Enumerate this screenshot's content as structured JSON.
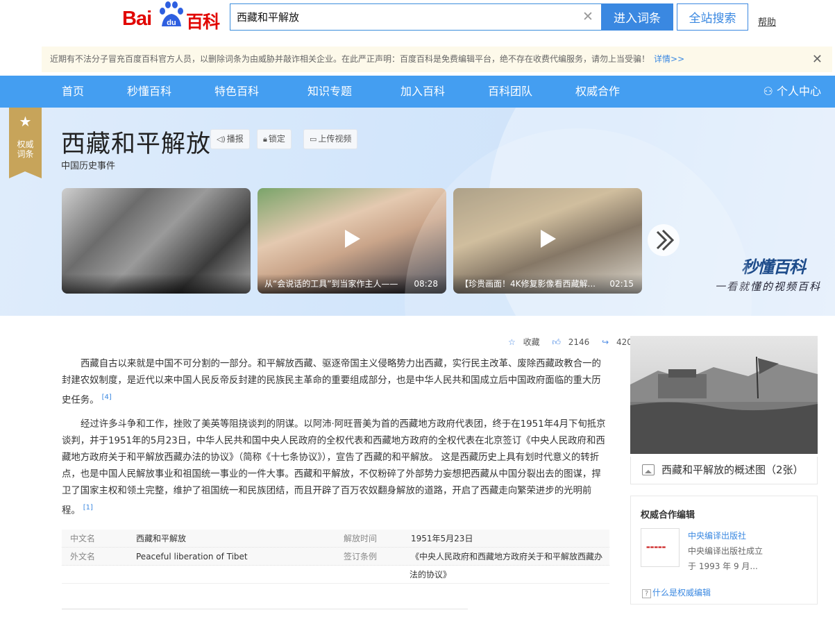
{
  "header": {
    "logo_bai": "Bai",
    "logo_du": "du",
    "logo_ke": "百科",
    "search_value": "西藏和平解放",
    "enter_label": "进入词条",
    "site_search_label": "全站搜索",
    "help_label": "帮助"
  },
  "notice": {
    "text": "近期有不法分子冒充百度百科官方人员，以删除词条为由威胁并敲诈相关企业。在此严正声明：百度百科是免费编辑平台，绝不存在收费代编服务，请勿上当受骗！",
    "more": "详情>>"
  },
  "nav": {
    "items": [
      "首页",
      "秒懂百科",
      "特色百科",
      "知识专题",
      "加入百科",
      "百科团队",
      "权威合作"
    ],
    "user_center": "个人中心"
  },
  "entry": {
    "badge": "权威词条",
    "title": "西藏和平解放",
    "broadcast_label": "播报",
    "lock_label": "锁定",
    "upload_label": "上传视频",
    "subtitle": "中国历史事件"
  },
  "videos": [
    {
      "caption": "",
      "duration": "",
      "color": "#8d8d8d"
    },
    {
      "caption": "从“会说话的工具”到当家作主人——",
      "duration": "08:28",
      "color": "#7a6a55"
    },
    {
      "caption": "【珍贵画面！4K修复影像看西藏解...",
      "duration": "02:15",
      "color": "#6f6352"
    }
  ],
  "miaodong": {
    "brand": "秒懂百科",
    "slogan": "一看就懂的视频百科"
  },
  "actions": {
    "collect": "收藏",
    "likes": "2146",
    "shares": "420"
  },
  "paragraphs": [
    {
      "text": "西藏自古以来就是中国不可分割的一部分。和平解放西藏、驱逐帝国主义侵略势力出西藏，实行民主改革、废除西藏政教合一的封建农奴制度，是近代以来中国人民反帝反封建的民族民主革命的重要组成部分，也是中华人民共和国成立后中国政府面临的重大历史任务。",
      "ref": "[4]"
    },
    {
      "text": "经过许多斗争和工作，挫败了美英等阻挠谈判的阴谋。以阿沛·阿旺晋美为首的西藏地方政府代表团，终于在1951年4月下旬抵京谈判，并于1951年的5月23日，中华人民共和国中央人民政府的全权代表和西藏地方政府的全权代表在北京签订《中央人民政府和西藏地方政府关于和平解放西藏办法的协议》（简称《十七条协议》），宣告了西藏的和平解放。 这是西藏历史上具有划时代意义的转折点，也是中国人民解放事业和祖国统一事业的一件大事。西藏和平解放，不仅粉碎了外部势力妄想把西藏从中国分裂出去的图谋，捍卫了国家主权和领土完整，维护了祖国统一和民族团结，而且开辟了百万农奴翻身解放的道路，开启了西藏走向繁荣进步的光明前程。",
      "ref": "[1]"
    }
  ],
  "infobox": [
    {
      "k1": "中文名",
      "v1": "西藏和平解放",
      "k2": "解放时间",
      "v2": "1951年5月23日"
    },
    {
      "k1": "外文名",
      "v1": "Peaceful liberation of Tibet",
      "k2": "签订条例",
      "v2": "《中央人民政府和西藏地方政府关于和平解放西藏办"
    },
    {
      "k1": "",
      "v1": "",
      "k2": "",
      "v2": "法的协议》"
    }
  ],
  "sidebar": {
    "album_caption": "西藏和平解放的概述图（2张）",
    "auth_heading": "权威合作编辑",
    "publisher": "中央编译出版社",
    "desc1": "中央编译出版社成立",
    "desc2": "于 1993 年 9 月...",
    "what_link": "什么是权威编辑"
  }
}
